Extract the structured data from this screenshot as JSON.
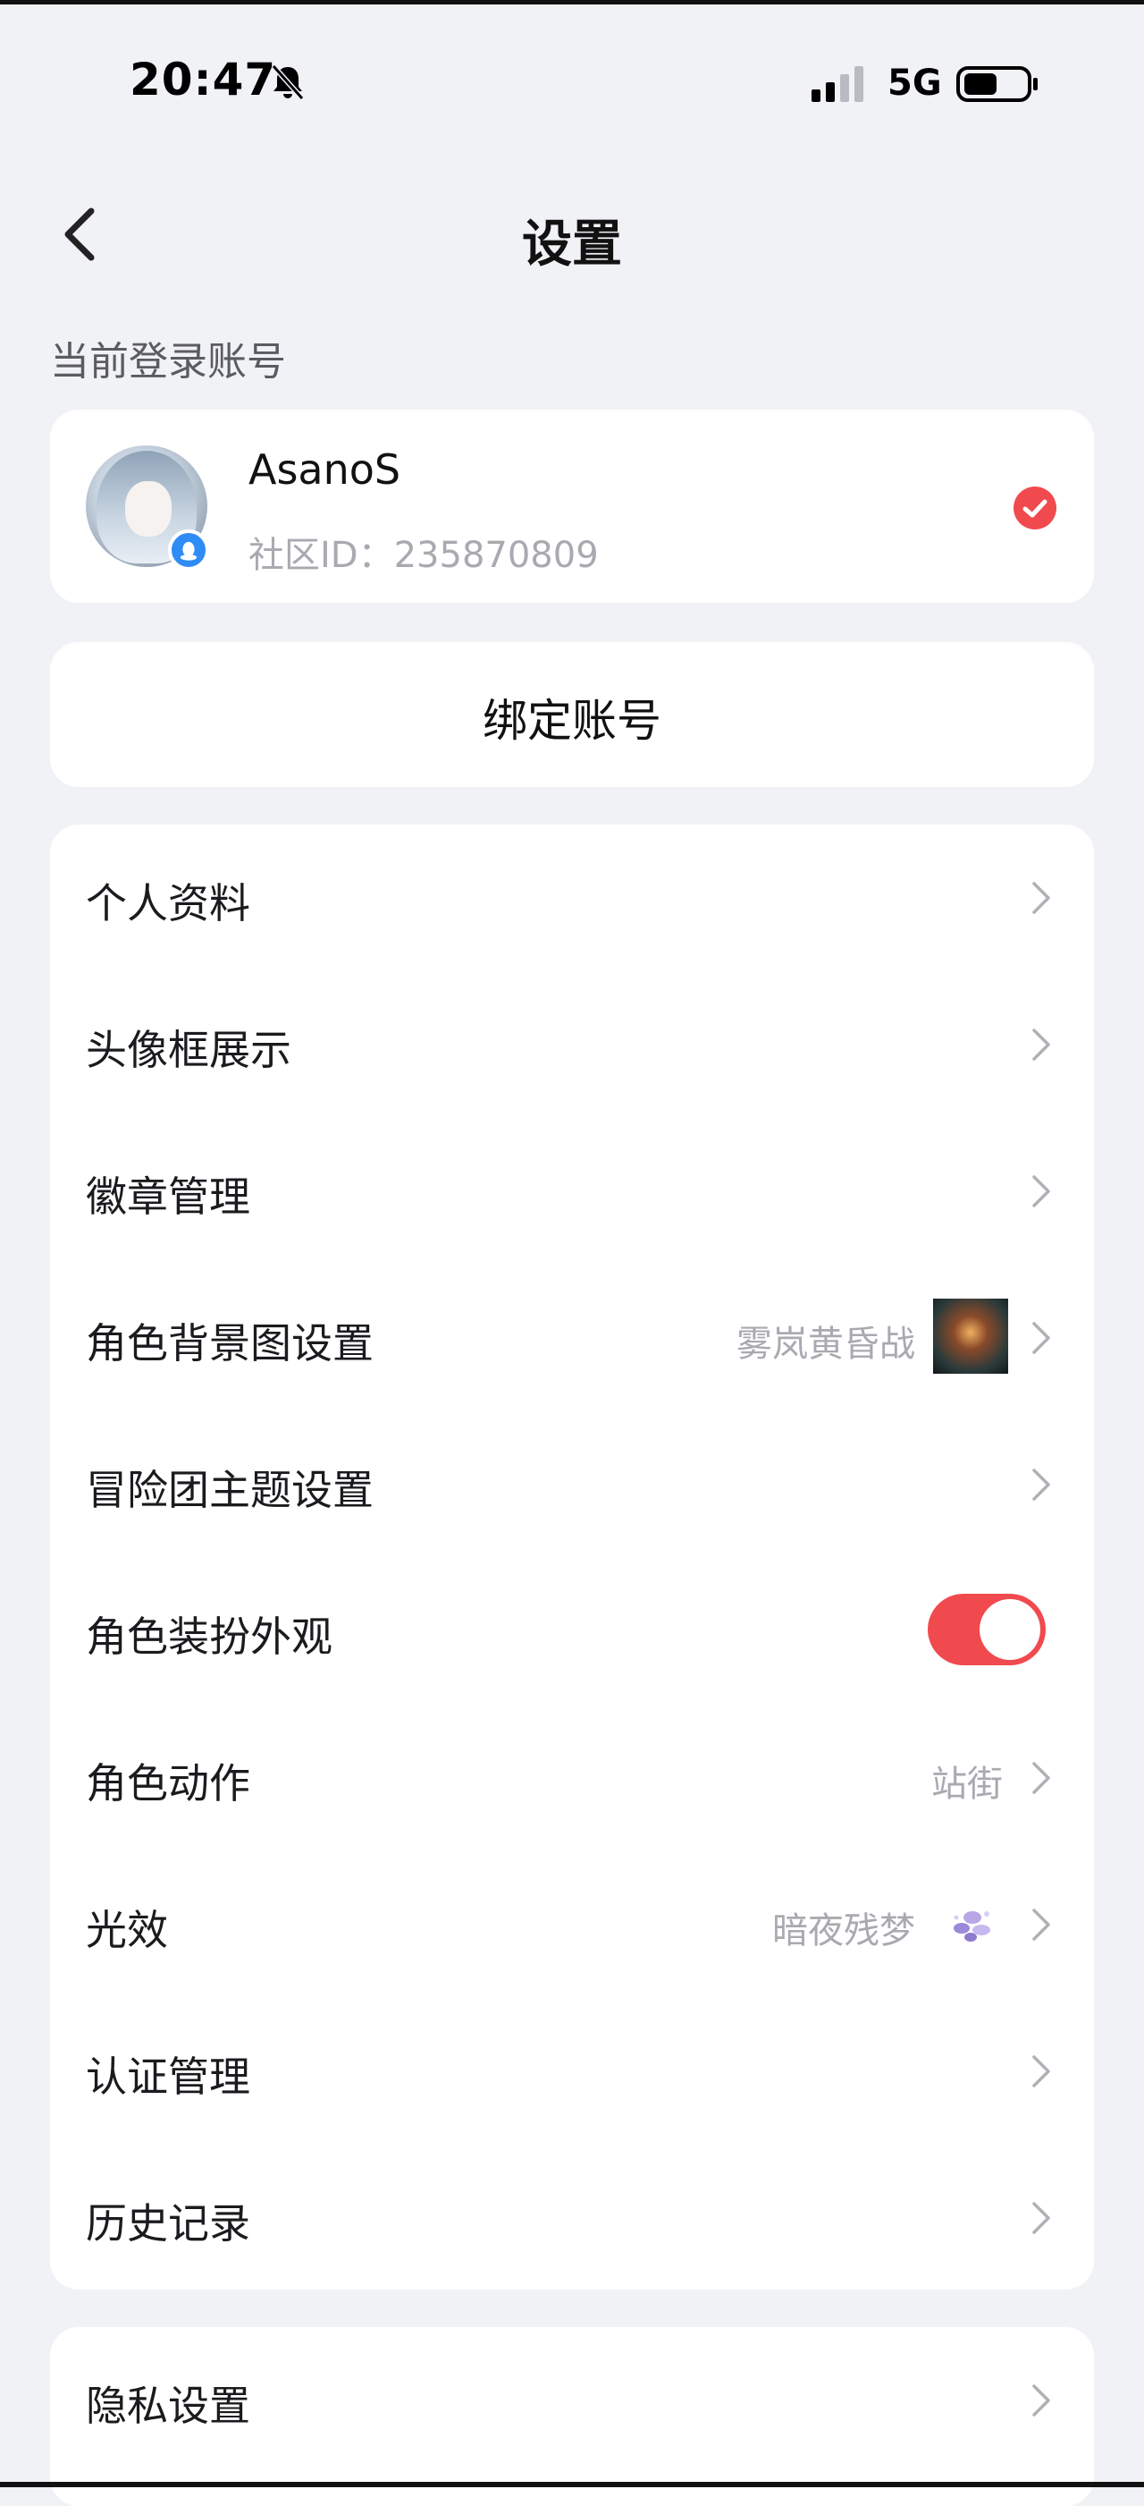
{
  "status_bar": {
    "time": "20:47",
    "network": "5G",
    "icons": [
      "bell-muted-icon",
      "signal-icon",
      "battery-icon"
    ],
    "battery_level": 0.55
  },
  "nav": {
    "title": "设置",
    "back_icon": "chevron-left-icon"
  },
  "account_section": {
    "label": "当前登录账号",
    "name": "AsanoS",
    "community_id": "社区ID：235870809",
    "selected": true
  },
  "bind_account": {
    "label": "绑定账号"
  },
  "menu": {
    "items": [
      {
        "label": "个人资料"
      },
      {
        "label": "头像框展示"
      },
      {
        "label": "徽章管理"
      },
      {
        "label": "角色背景图设置",
        "value": "雾岚黄昏战"
      },
      {
        "label": "冒险团主题设置"
      },
      {
        "label": "角色装扮外观",
        "toggle_on": true
      },
      {
        "label": "角色动作",
        "value": "站街"
      },
      {
        "label": "光效",
        "value": "暗夜残梦"
      },
      {
        "label": "认证管理"
      },
      {
        "label": "历史记录"
      }
    ]
  },
  "privacy": {
    "label": "隐私设置"
  },
  "colors": {
    "background": "#f1f2f6",
    "card": "#ffffff",
    "accent_red": "#f04a4e",
    "muted_text": "#a9a9b0"
  }
}
